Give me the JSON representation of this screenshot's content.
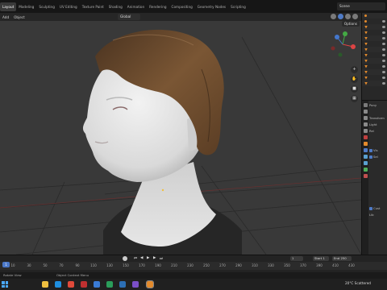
{
  "workspace_tabs": [
    "Layout",
    "Modeling",
    "Sculpting",
    "UV Editing",
    "Texture Paint",
    "Shading",
    "Animation",
    "Rendering",
    "Compositing",
    "Geometry Nodes",
    "Scripting"
  ],
  "scene_name": "Scene",
  "viewport_header": {
    "menu": [
      "Add",
      "Object"
    ],
    "orientation_label": "Global",
    "options_label": "Options"
  },
  "outliner": {
    "header": "Scene Collection",
    "rows": [
      "Scene Collection",
      "Collection",
      "Mesh",
      "Mesh",
      "Mesh",
      "Mesh",
      "Mesh",
      "Mesh",
      "Mesh",
      "Mesh",
      "Mesh",
      "Mesh",
      "Mesh"
    ]
  },
  "properties": {
    "rows": [
      "Pony",
      "",
      "Transform",
      "Light",
      "Rel",
      "",
      "",
      "Vis",
      "Sel",
      "",
      "",
      "",
      "",
      "",
      "",
      "",
      "Cust",
      "Lib"
    ]
  },
  "timeline": {
    "ticks": [
      "10",
      "30",
      "50",
      "70",
      "90",
      "110",
      "130",
      "150",
      "170",
      "190",
      "210",
      "230",
      "250",
      "270",
      "290",
      "310",
      "330",
      "350",
      "370",
      "390",
      "410",
      "430"
    ],
    "current_frame": "1",
    "start_label": "Start",
    "start_value": "1",
    "end_label": "End",
    "end_value": "250"
  },
  "status_bar": {
    "left": "Rotate View",
    "middle": "Object Context Menu"
  },
  "taskbar": {
    "weather": "20°C  Scattered"
  },
  "colors": {
    "accent": "#4b78c8",
    "object_orange": "#e38a2c",
    "viewport_bg": "#393939"
  }
}
